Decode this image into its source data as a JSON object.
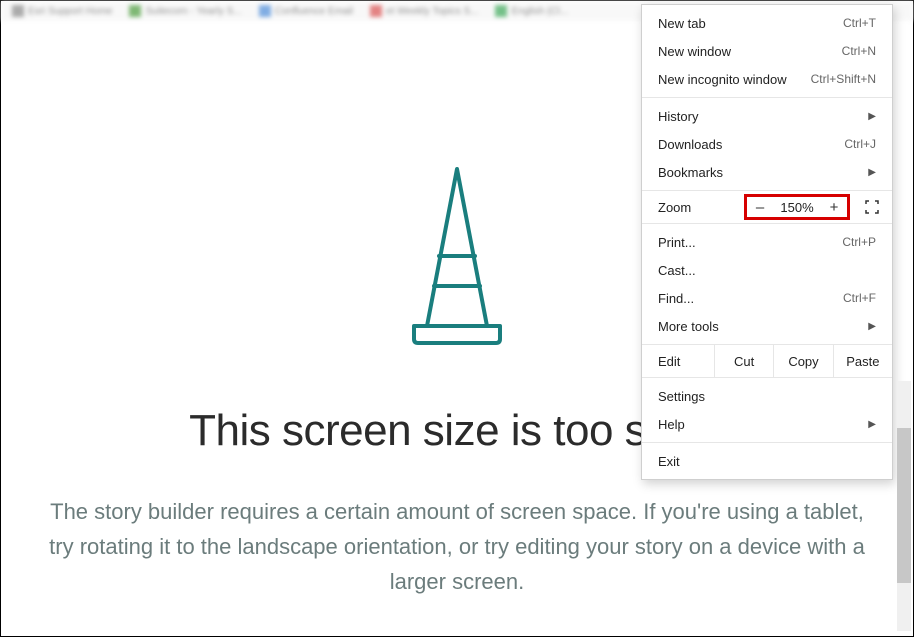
{
  "tabs": [
    {
      "icon_color": "#888",
      "label": "Esri Support Home"
    },
    {
      "icon_color": "#4a9b3b",
      "label": "Suitecorn - Yearly S..."
    },
    {
      "icon_color": "#4b8bd8",
      "label": "Confluence Email"
    },
    {
      "icon_color": "#d94f4f",
      "label": "et Weekly Topics S..."
    },
    {
      "icon_color": "#3aa757",
      "label": "English (Cl..."
    }
  ],
  "page": {
    "headline": "This screen size is too small",
    "subtext": "The story builder requires a certain amount of screen space. If you're using a tablet, try rotating it to the landscape orientation, or try editing your story on a device with a larger screen.",
    "cone_color": "#1a7e7e"
  },
  "menu": {
    "new_tab": {
      "label": "New tab",
      "shortcut": "Ctrl+T"
    },
    "new_window": {
      "label": "New window",
      "shortcut": "Ctrl+N"
    },
    "new_incognito": {
      "label": "New incognito window",
      "shortcut": "Ctrl+Shift+N"
    },
    "history": {
      "label": "History"
    },
    "downloads": {
      "label": "Downloads",
      "shortcut": "Ctrl+J"
    },
    "bookmarks": {
      "label": "Bookmarks"
    },
    "zoom": {
      "label": "Zoom",
      "value": "150%",
      "minus": "–",
      "plus": "+"
    },
    "print": {
      "label": "Print...",
      "shortcut": "Ctrl+P"
    },
    "cast": {
      "label": "Cast..."
    },
    "find": {
      "label": "Find...",
      "shortcut": "Ctrl+F"
    },
    "more_tools": {
      "label": "More tools"
    },
    "edit": {
      "label": "Edit",
      "cut": "Cut",
      "copy": "Copy",
      "paste": "Paste"
    },
    "settings": {
      "label": "Settings"
    },
    "help": {
      "label": "Help"
    },
    "exit": {
      "label": "Exit"
    }
  }
}
